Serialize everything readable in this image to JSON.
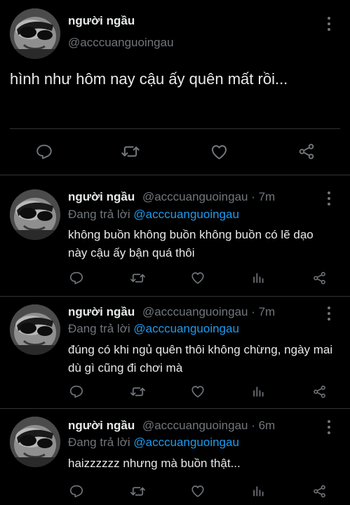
{
  "main_tweet": {
    "author_name": "người ngầu",
    "handle": "@acccuanguoingau",
    "text": "hình như hôm nay cậu ấy quên mất rồi...",
    "actions": [
      "reply-icon",
      "retweet-icon",
      "like-icon",
      "share-icon"
    ]
  },
  "replies": [
    {
      "author_name": "người ngầu",
      "handle_time": "@acccuanguoingau · 7m",
      "replying_prefix": "Đang trả lời",
      "replying_to": "@acccuanguoingau",
      "text": "không buồn không buồn không buồn có lẽ dạo này cậu ấy bận quá thôi",
      "actions": [
        "reply-icon",
        "retweet-icon",
        "like-icon",
        "analytics-icon",
        "share-icon"
      ]
    },
    {
      "author_name": "người ngầu",
      "handle_time": "@acccuanguoingau · 7m",
      "replying_prefix": "Đang trả lời",
      "replying_to": "@acccuanguoingau",
      "text": "đúng có khi ngủ quên thôi không chừng, ngày mai dù gì cũng đi chơi mà",
      "actions": [
        "reply-icon",
        "retweet-icon",
        "like-icon",
        "analytics-icon",
        "share-icon"
      ]
    },
    {
      "author_name": "người ngầu",
      "handle_time": "@acccuanguoingau · 6m",
      "replying_prefix": "Đang trả lời",
      "replying_to": "@acccuanguoingau",
      "text": "haizzzzzz nhưng mà buồn thật...",
      "actions": [
        "reply-icon",
        "retweet-icon",
        "like-icon",
        "analytics-icon",
        "share-icon"
      ]
    }
  ],
  "colors": {
    "background": "#000000",
    "primary_text": "#e7e9ea",
    "secondary_text": "#71767b",
    "mention": "#1d9bf0",
    "divider": "#2f3336"
  }
}
